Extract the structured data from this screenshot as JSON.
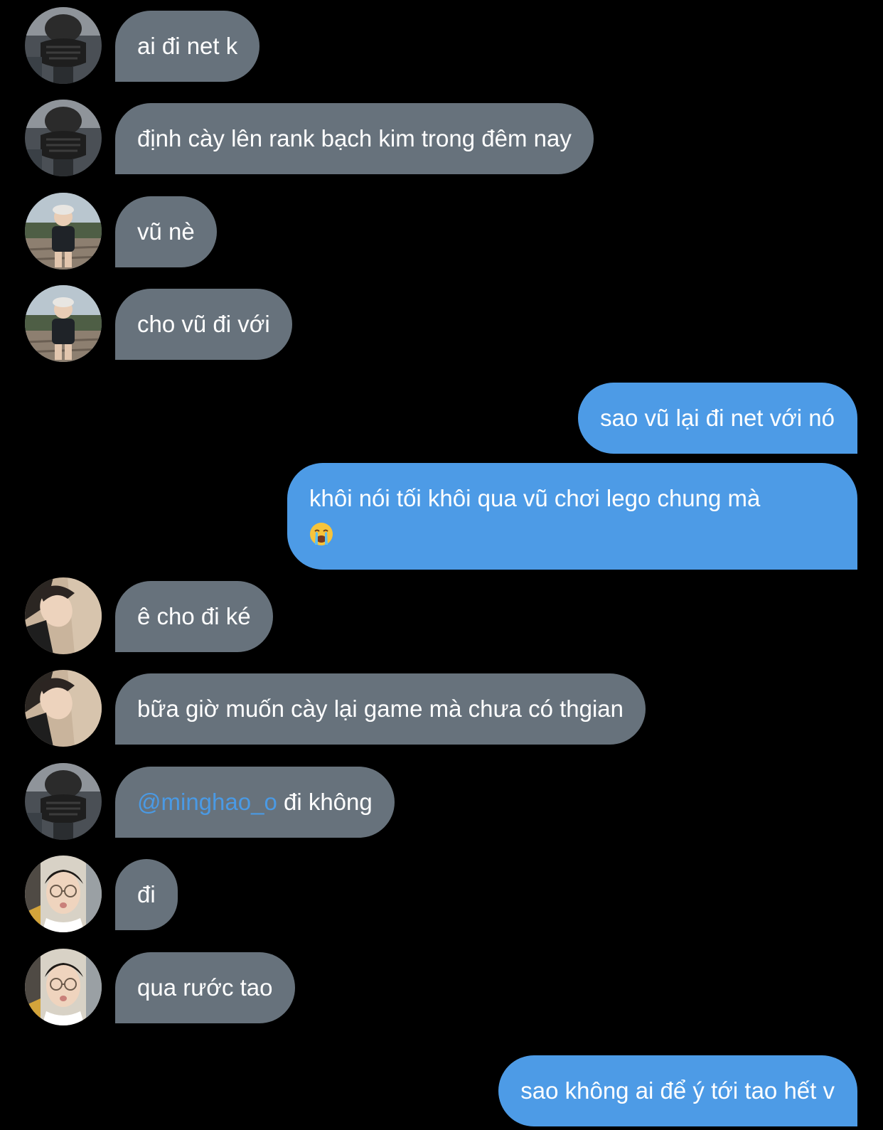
{
  "conversation": {
    "messages": [
      {
        "sender": "masked",
        "direction": "in",
        "text": "ai đi net k"
      },
      {
        "sender": "masked",
        "direction": "in",
        "text": "định cày lên rank bạch kim trong đêm nay"
      },
      {
        "sender": "child",
        "direction": "in",
        "text": "vũ nè"
      },
      {
        "sender": "child",
        "direction": "in",
        "text": "cho vũ đi với"
      },
      {
        "sender": "me",
        "direction": "out",
        "text": "sao vũ lại đi net với nó"
      },
      {
        "sender": "me",
        "direction": "out",
        "text": "khôi nói tối khôi qua vũ chơi lego chung mà",
        "emoji": "loudly-crying-face"
      },
      {
        "sender": "tilted",
        "direction": "in",
        "text": "ê cho đi ké"
      },
      {
        "sender": "tilted",
        "direction": "in",
        "text": "bữa giờ muốn cày lại game mà chưa có thgian"
      },
      {
        "sender": "masked",
        "direction": "in",
        "mention": "@minghao_o",
        "text": " đi không"
      },
      {
        "sender": "glasses",
        "direction": "in",
        "text": "đi"
      },
      {
        "sender": "glasses",
        "direction": "in",
        "text": "qua rước tao"
      },
      {
        "sender": "me",
        "direction": "out",
        "text": "sao không ai để ý tới tao hết v"
      }
    ]
  },
  "colors": {
    "background": "#000000",
    "incoming_bubble": "#67727c",
    "outgoing_bubble": "#4d9be6",
    "mention": "#4a9ae5",
    "text": "#ffffff"
  }
}
